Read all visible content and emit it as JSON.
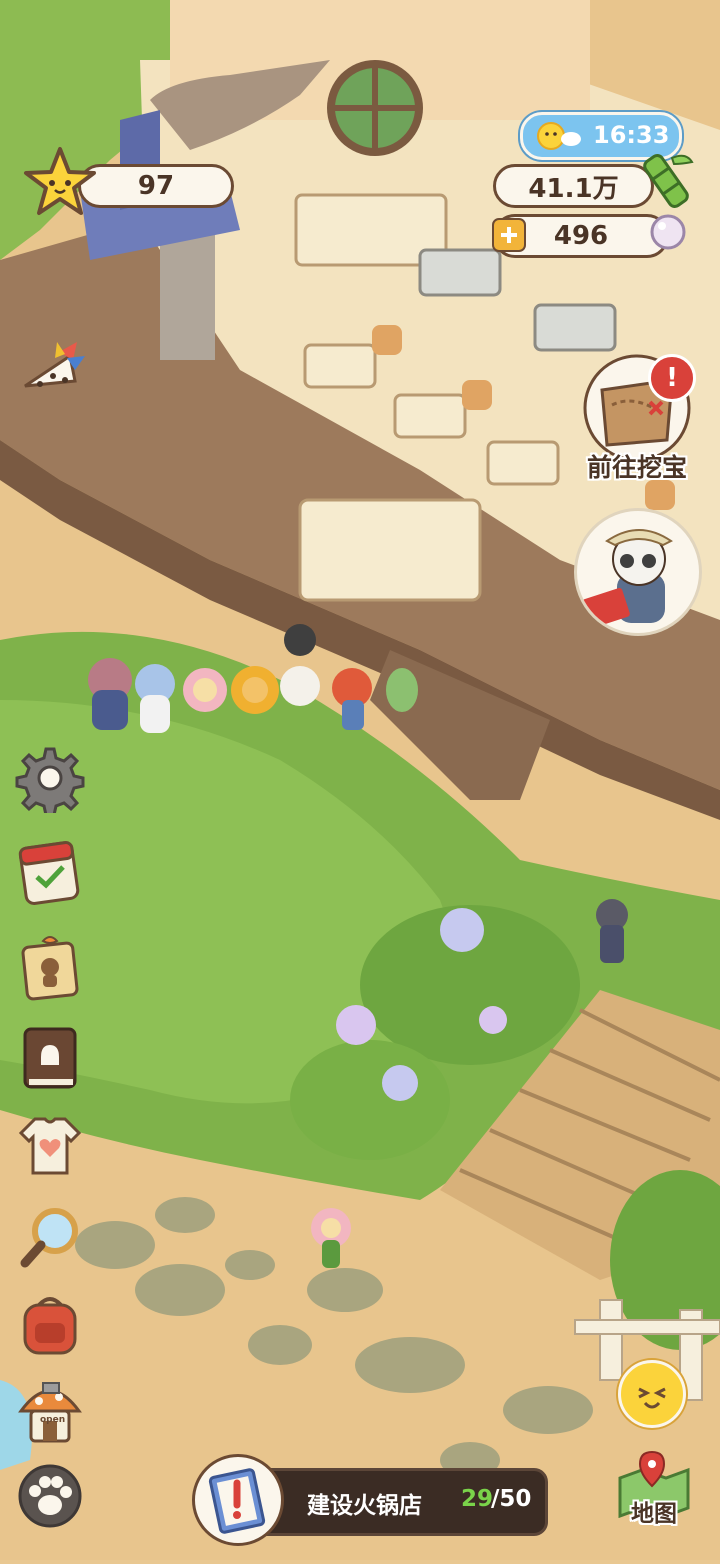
{
  "hud": {
    "star_count": "97",
    "clock": "16:33",
    "money": "41.1万",
    "pearls": "496"
  },
  "treasure": {
    "label": "前往挖宝",
    "alert": "!"
  },
  "bottom_task": {
    "title": "建设火锅店",
    "progress_current": "29",
    "progress_total": "/50"
  },
  "map_button": {
    "label": "地图"
  },
  "shop_sign": {
    "label": "open"
  },
  "icons": {
    "side_buttons": [
      "pinwheel-icon",
      "settings-gear-icon",
      "calendar-checklist-icon",
      "gift-tag-icon",
      "recipe-book-icon",
      "tshirt-heart-icon",
      "magnifier-icon",
      "backpack-icon",
      "mushroom-shop-icon",
      "paw-icon"
    ],
    "face_button": "smiley-face-icon"
  },
  "colors": {
    "outline": "#6b4a33",
    "accent_blue": "#7cc4ef",
    "progress_green": "#3fa32a",
    "alert_red": "#d9413a"
  }
}
